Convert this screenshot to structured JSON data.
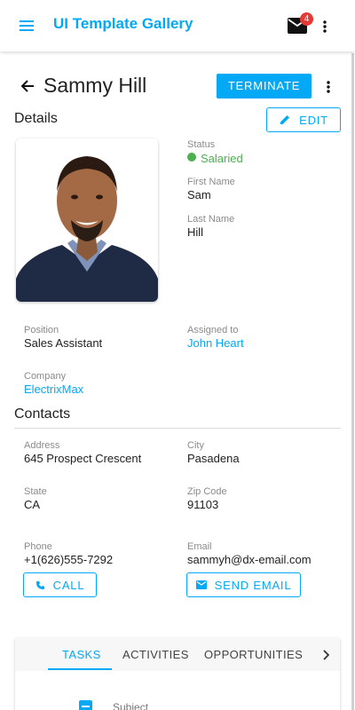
{
  "app": {
    "title": "UI Template Gallery",
    "mail_badge": "4",
    "accent_color": "#03a9f4",
    "icons": {
      "menu": "menu-icon",
      "mail": "mail-icon",
      "more": "more-vert-icon"
    }
  },
  "header": {
    "name": "Sammy Hill",
    "terminate_label": "TERMINATE",
    "back_icon": "arrow-back-icon"
  },
  "details": {
    "title": "Details",
    "edit_label": "EDIT",
    "status_label": "Status",
    "status_value": "Salaried",
    "status_color": "#4caf50",
    "first_name_label": "First Name",
    "first_name": "Sam",
    "last_name_label": "Last Name",
    "last_name": "Hill",
    "position_label": "Position",
    "position": "Sales Assistant",
    "assigned_label": "Assigned to",
    "assigned": "John Heart",
    "company_label": "Company",
    "company": "ElectrixMax"
  },
  "contacts": {
    "title": "Contacts",
    "address_label": "Address",
    "address": "645 Prospect Crescent",
    "city_label": "City",
    "city": "Pasadena",
    "state_label": "State",
    "state": "CA",
    "zip_label": "Zip Code",
    "zip": "91103",
    "phone_label": "Phone",
    "phone": "+1(626)555-7292",
    "email_label": "Email",
    "email": "sammyh@dx-email.com",
    "call_label": "CALL",
    "send_email_label": "SEND EMAIL"
  },
  "tabs": {
    "items": [
      "TASKS",
      "ACTIVITIES",
      "OPPORTUNITIES"
    ],
    "active": "TASKS",
    "column_header": "Subject"
  }
}
